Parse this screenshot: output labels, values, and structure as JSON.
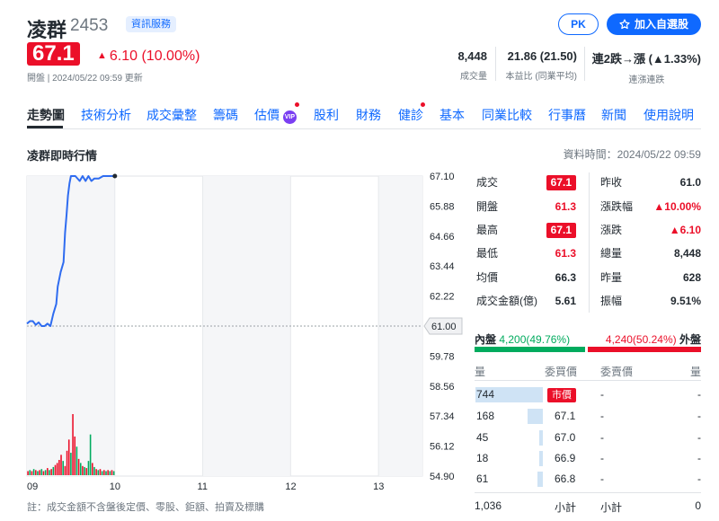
{
  "header": {
    "name": "凌群",
    "code": "2453",
    "info_tag": "資訊服務",
    "pk_label": "PK",
    "watch_label": "加入自選股",
    "price": "67.1",
    "change_text": "6.10 (10.00%)",
    "status_line": "開盤 | 2024/05/22 09:59 更新"
  },
  "header_stats": [
    {
      "value": "8,448",
      "label": "成交量"
    },
    {
      "value": "21.86 (21.50)",
      "label": "本益比 (同業平均)"
    },
    {
      "value": "連2跌→漲 (▲1.33%)",
      "label": "連漲連跌"
    }
  ],
  "tabs": [
    {
      "label": "走勢圖",
      "active": true
    },
    {
      "label": "技術分析"
    },
    {
      "label": "成交彙整"
    },
    {
      "label": "籌碼"
    },
    {
      "label": "估價",
      "vip": "VIP",
      "badge": true
    },
    {
      "label": "股利"
    },
    {
      "label": "財務"
    },
    {
      "label": "健診",
      "badge": true
    },
    {
      "label": "基本"
    },
    {
      "label": "同業比較"
    },
    {
      "label": "行事曆"
    },
    {
      "label": "新聞"
    },
    {
      "label": "使用說明"
    }
  ],
  "section": {
    "title": "凌群即時行情",
    "time": "資料時間：2024/05/22 09:59"
  },
  "chart_data": {
    "type": "line",
    "x_ticks": [
      "09",
      "10",
      "11",
      "12",
      "13"
    ],
    "y_ticks": [
      "67.10",
      "65.88",
      "64.66",
      "63.44",
      "62.22",
      "61.00",
      "59.78",
      "58.56",
      "57.34",
      "56.12",
      "54.90"
    ],
    "ylim": [
      54.9,
      67.1
    ],
    "reference_price": 61.0,
    "reference_label": "61.00",
    "price_series": [
      [
        0,
        61.1
      ],
      [
        2,
        61.2
      ],
      [
        4,
        61.2
      ],
      [
        6,
        61.05
      ],
      [
        8,
        61.15
      ],
      [
        10,
        61.0
      ],
      [
        12,
        61.0
      ],
      [
        14,
        61.1
      ],
      [
        16,
        61.0
      ],
      [
        18,
        61.5
      ],
      [
        20,
        61.9
      ],
      [
        21,
        62.6
      ],
      [
        23,
        63.2
      ],
      [
        25,
        63.6
      ],
      [
        26,
        64.8
      ],
      [
        27,
        65.5
      ],
      [
        28,
        66.3
      ],
      [
        29,
        66.8
      ],
      [
        30,
        67.1
      ],
      [
        33,
        67.1
      ],
      [
        36,
        66.9
      ],
      [
        38,
        67.1
      ],
      [
        40,
        66.9
      ],
      [
        42,
        67.1
      ],
      [
        44,
        66.9
      ],
      [
        46,
        67.0
      ],
      [
        49,
        67.0
      ],
      [
        52,
        67.1
      ],
      [
        56,
        67.1
      ],
      [
        60,
        67.1
      ]
    ],
    "volume_bars": [
      {
        "v": 4,
        "c": "r"
      },
      {
        "v": 5,
        "c": "g"
      },
      {
        "v": 4,
        "c": "r"
      },
      {
        "v": 6,
        "c": "g"
      },
      {
        "v": 5,
        "c": "r"
      },
      {
        "v": 4,
        "c": "g"
      },
      {
        "v": 5,
        "c": "r"
      },
      {
        "v": 6,
        "c": "g"
      },
      {
        "v": 4,
        "c": "r"
      },
      {
        "v": 5,
        "c": "g"
      },
      {
        "v": 7,
        "c": "r"
      },
      {
        "v": 5,
        "c": "g"
      },
      {
        "v": 6,
        "c": "r"
      },
      {
        "v": 8,
        "c": "g"
      },
      {
        "v": 10,
        "c": "r"
      },
      {
        "v": 12,
        "c": "r"
      },
      {
        "v": 15,
        "c": "r"
      },
      {
        "v": 20,
        "c": "r"
      },
      {
        "v": 14,
        "c": "g"
      },
      {
        "v": 9,
        "c": "r"
      },
      {
        "v": 24,
        "c": "r"
      },
      {
        "v": 35,
        "c": "r"
      },
      {
        "v": 22,
        "c": "g"
      },
      {
        "v": 60,
        "c": "r"
      },
      {
        "v": 38,
        "c": "r"
      },
      {
        "v": 28,
        "c": "g"
      },
      {
        "v": 16,
        "c": "r"
      },
      {
        "v": 12,
        "c": "g"
      },
      {
        "v": 9,
        "c": "r"
      },
      {
        "v": 8,
        "c": "g"
      },
      {
        "v": 7,
        "c": "r"
      },
      {
        "v": 14,
        "c": "g"
      },
      {
        "v": 40,
        "c": "g"
      },
      {
        "v": 12,
        "c": "r"
      },
      {
        "v": 8,
        "c": "g"
      },
      {
        "v": 6,
        "c": "r"
      },
      {
        "v": 5,
        "c": "g"
      },
      {
        "v": 6,
        "c": "r"
      },
      {
        "v": 4,
        "c": "g"
      },
      {
        "v": 5,
        "c": "r"
      },
      {
        "v": 4,
        "c": "g"
      },
      {
        "v": 5,
        "c": "r"
      },
      {
        "v": 4,
        "c": "g"
      },
      {
        "v": 5,
        "c": "r"
      },
      {
        "v": 4,
        "c": "g"
      }
    ]
  },
  "quote_left": [
    {
      "label": "成交",
      "value": "67.1",
      "style": "badge"
    },
    {
      "label": "開盤",
      "value": "61.3",
      "style": "red"
    },
    {
      "label": "最高",
      "value": "67.1",
      "style": "badge"
    },
    {
      "label": "最低",
      "value": "61.3",
      "style": "red"
    },
    {
      "label": "均價",
      "value": "66.3",
      "style": "plain"
    },
    {
      "label": "成交金額(億)",
      "value": "5.61",
      "style": "plain"
    }
  ],
  "quote_right": [
    {
      "label": "昨收",
      "value": "61.0",
      "style": "plain"
    },
    {
      "label": "漲跌幅",
      "value": "▲10.00%",
      "style": "red"
    },
    {
      "label": "漲跌",
      "value": "▲6.10",
      "style": "red"
    },
    {
      "label": "總量",
      "value": "8,448",
      "style": "plain"
    },
    {
      "label": "昨量",
      "value": "628",
      "style": "plain"
    },
    {
      "label": "振幅",
      "value": "9.51%",
      "style": "plain"
    }
  ],
  "order_book": {
    "inner_label": "內盤",
    "inner_value": "4,200(49.76%)",
    "outer_value": "4,240(50.24%)",
    "outer_label": "外盤",
    "inner_pct": 49.76,
    "col_qty": "量",
    "col_bid": "委買價",
    "col_ask": "委賣價",
    "col_qty2": "量",
    "market_label": "市價",
    "rows": [
      {
        "qty": "744",
        "bid": "",
        "ask": "-",
        "ask_qty": "-",
        "bar": 1.0
      },
      {
        "qty": "168",
        "bid": "67.1",
        "ask": "-",
        "ask_qty": "-",
        "bar": 0.226
      },
      {
        "qty": "45",
        "bid": "67.0",
        "ask": "-",
        "ask_qty": "-",
        "bar": 0.06
      },
      {
        "qty": "18",
        "bid": "66.9",
        "ask": "-",
        "ask_qty": "-",
        "bar": 0.024
      },
      {
        "qty": "61",
        "bid": "66.8",
        "ask": "-",
        "ask_qty": "-",
        "bar": 0.082
      }
    ],
    "total_bid_qty": "1,036",
    "subtotal_label": "小計",
    "subtotal_label2": "小計",
    "total_ask_qty": "0"
  },
  "footnote": "註：成交金額不含盤後定價、零股、鉅額、拍賣及標購"
}
